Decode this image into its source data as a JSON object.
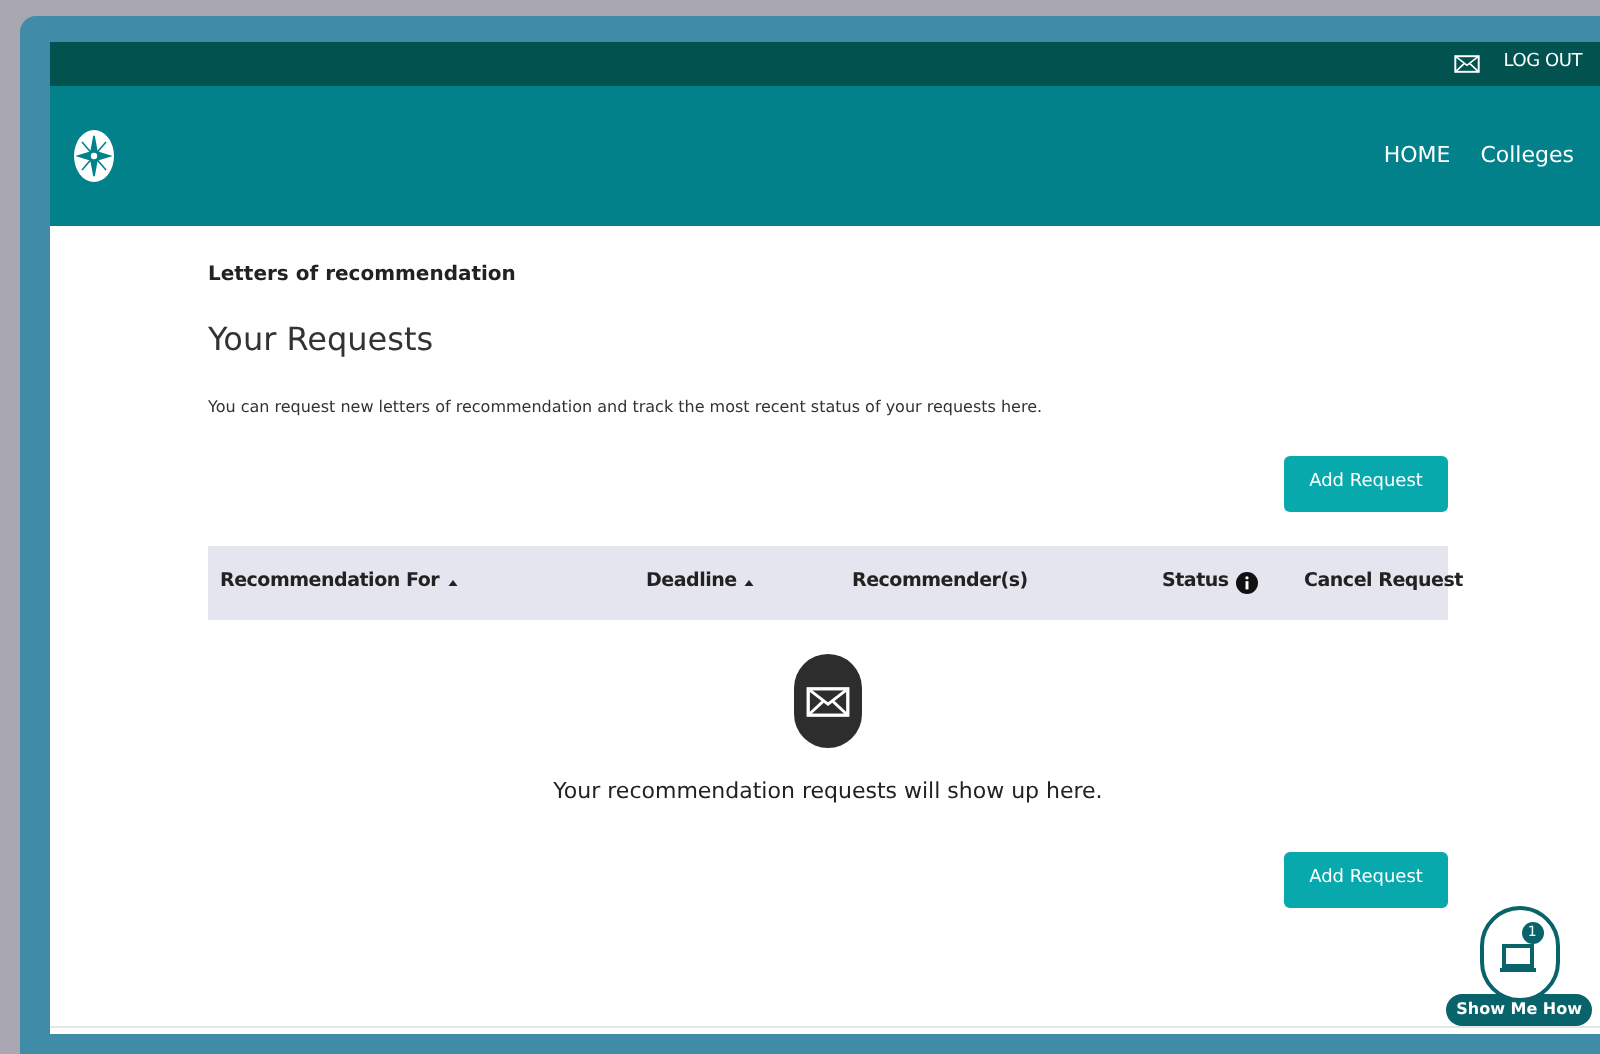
{
  "top_bar": {
    "logout": "LOG OUT"
  },
  "nav": {
    "items": [
      "HOME",
      "Colleges"
    ]
  },
  "breadcrumb": "Letters of recommendation",
  "heading": "Your Requests",
  "intro": "You can request new letters of recommendation and track the most recent status of your requests here.",
  "add_button_top": "Add Request",
  "table": {
    "columns": [
      {
        "label": "Recommendation For",
        "kind": "sortable"
      },
      {
        "label": "Deadline",
        "kind": "sortable"
      },
      {
        "label": "Recommender(s)",
        "kind": "plain"
      },
      {
        "label": "Status",
        "kind": "info"
      },
      {
        "label": "Cancel Request",
        "kind": "plain"
      }
    ]
  },
  "empty_message": "Your recommendation requests will show up here.",
  "add_button_bottom": "Add Request",
  "help_widget": {
    "label": "Show Me How",
    "badge": "1"
  }
}
